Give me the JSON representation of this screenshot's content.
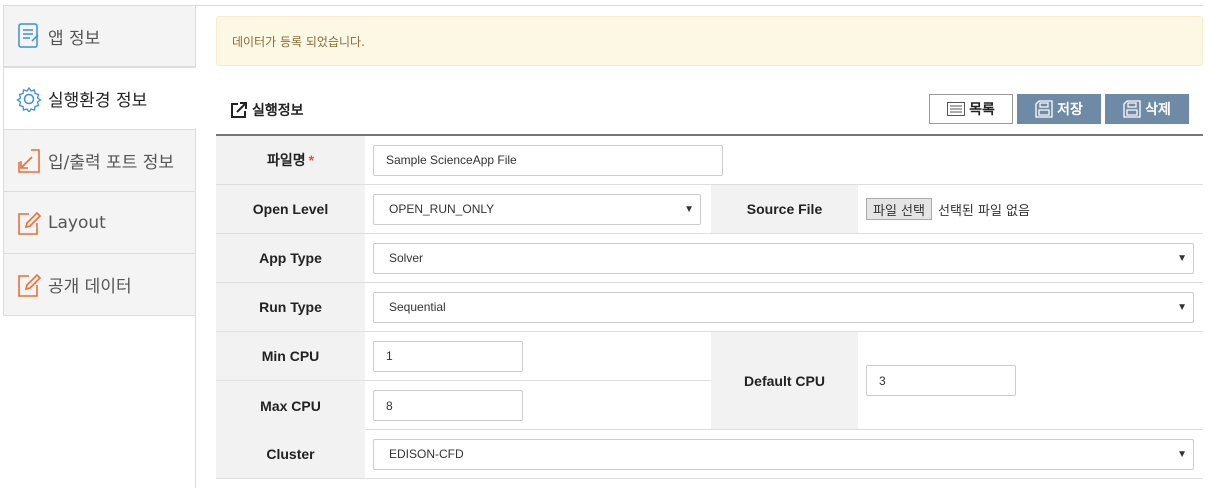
{
  "sidebar": {
    "items": [
      {
        "label": "앱 정보",
        "icon": "document-icon"
      },
      {
        "label": "실행환경 정보",
        "icon": "gear-icon"
      },
      {
        "label": "입/출력 포트 정보",
        "icon": "arrow-in-icon"
      },
      {
        "label": "Layout",
        "icon": "edit-icon"
      },
      {
        "label": "공개 데이터",
        "icon": "edit-icon"
      }
    ]
  },
  "alert": {
    "message": "데이터가 등록 되었습니다."
  },
  "section": {
    "title": "실행정보"
  },
  "toolbar": {
    "list_label": "목록",
    "save_label": "저장",
    "delete_label": "삭제"
  },
  "form": {
    "file_name": {
      "label": "파일명",
      "required_mark": "*",
      "value": "Sample ScienceApp File"
    },
    "open_level": {
      "label": "Open Level",
      "value": "OPEN_RUN_ONLY"
    },
    "source_file": {
      "label": "Source File",
      "button": "파일 선택",
      "status": "선택된 파일 없음"
    },
    "app_type": {
      "label": "App Type",
      "value": "Solver"
    },
    "run_type": {
      "label": "Run Type",
      "value": "Sequential"
    },
    "min_cpu": {
      "label": "Min CPU",
      "value": "1"
    },
    "max_cpu": {
      "label": "Max CPU",
      "value": "8"
    },
    "default_cpu": {
      "label": "Default CPU",
      "value": "3"
    },
    "cluster": {
      "label": "Cluster",
      "value": "EDISON-CFD"
    }
  },
  "colors": {
    "accent_icon": "#e8703a",
    "gear_icon": "#3a8ee0",
    "button_dark": "#6e8aa6",
    "alert_bg": "#fcf8e3",
    "required": "#d9534f"
  }
}
